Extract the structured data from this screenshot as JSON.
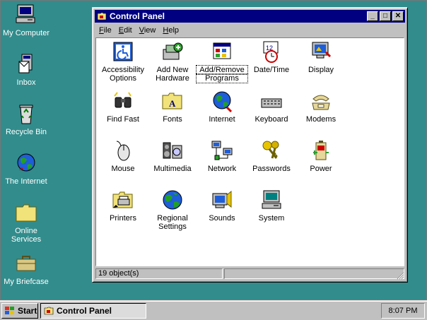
{
  "desktop": {
    "icons": [
      {
        "label": "My Computer",
        "icon": "my-computer-icon"
      },
      {
        "label": "Inbox",
        "icon": "inbox-icon"
      },
      {
        "label": "Recycle Bin",
        "icon": "recycle-bin-icon"
      },
      {
        "label": "The Internet",
        "icon": "internet-globe-icon"
      },
      {
        "label": "Online Services",
        "label_line1": "Online",
        "label_line2": "Services",
        "icon": "folder-icon"
      },
      {
        "label": "My Briefcase",
        "icon": "briefcase-icon"
      }
    ]
  },
  "window": {
    "title": "Control Panel",
    "buttons": {
      "minimize": "_",
      "maximize": "□",
      "close": "✕"
    },
    "menu": [
      {
        "key": "F",
        "rest": "ile"
      },
      {
        "key": "E",
        "rest": "dit"
      },
      {
        "key": "V",
        "rest": "iew"
      },
      {
        "key": "H",
        "rest": "elp"
      }
    ],
    "items": [
      {
        "l1": "Accessibility",
        "l2": "Options",
        "icon": "accessibility-icon"
      },
      {
        "l1": "Add New",
        "l2": "Hardware",
        "icon": "add-hardware-icon"
      },
      {
        "l1": "Add/Remove",
        "l2": "Programs",
        "icon": "add-remove-programs-icon",
        "selected": true
      },
      {
        "l1": "Date/Time",
        "l2": "",
        "icon": "date-time-icon"
      },
      {
        "l1": "Display",
        "l2": "",
        "icon": "display-icon"
      },
      {
        "l1": "Find Fast",
        "l2": "",
        "icon": "binoculars-icon"
      },
      {
        "l1": "Fonts",
        "l2": "",
        "icon": "fonts-folder-icon"
      },
      {
        "l1": "Internet",
        "l2": "",
        "icon": "internet-globe-icon"
      },
      {
        "l1": "Keyboard",
        "l2": "",
        "icon": "keyboard-icon"
      },
      {
        "l1": "Modems",
        "l2": "",
        "icon": "modem-phone-icon"
      },
      {
        "l1": "Mouse",
        "l2": "",
        "icon": "mouse-icon"
      },
      {
        "l1": "Multimedia",
        "l2": "",
        "icon": "multimedia-icon"
      },
      {
        "l1": "Network",
        "l2": "",
        "icon": "network-icon"
      },
      {
        "l1": "Passwords",
        "l2": "",
        "icon": "keys-icon"
      },
      {
        "l1": "Power",
        "l2": "",
        "icon": "power-battery-icon"
      },
      {
        "l1": "Printers",
        "l2": "",
        "icon": "printers-folder-icon"
      },
      {
        "l1": "Regional",
        "l2": "Settings",
        "icon": "regional-globe-icon"
      },
      {
        "l1": "Sounds",
        "l2": "",
        "icon": "sounds-icon"
      },
      {
        "l1": "System",
        "l2": "",
        "icon": "system-computer-icon"
      }
    ],
    "status": {
      "objects": "19 object(s)",
      "right": ""
    }
  },
  "taskbar": {
    "start_label": "Start",
    "task_label": "Control Panel",
    "clock": "8:07 PM"
  },
  "colors": {
    "desktop": "#328c8c",
    "title_bar": "#000080",
    "face": "#c0c0c0"
  }
}
